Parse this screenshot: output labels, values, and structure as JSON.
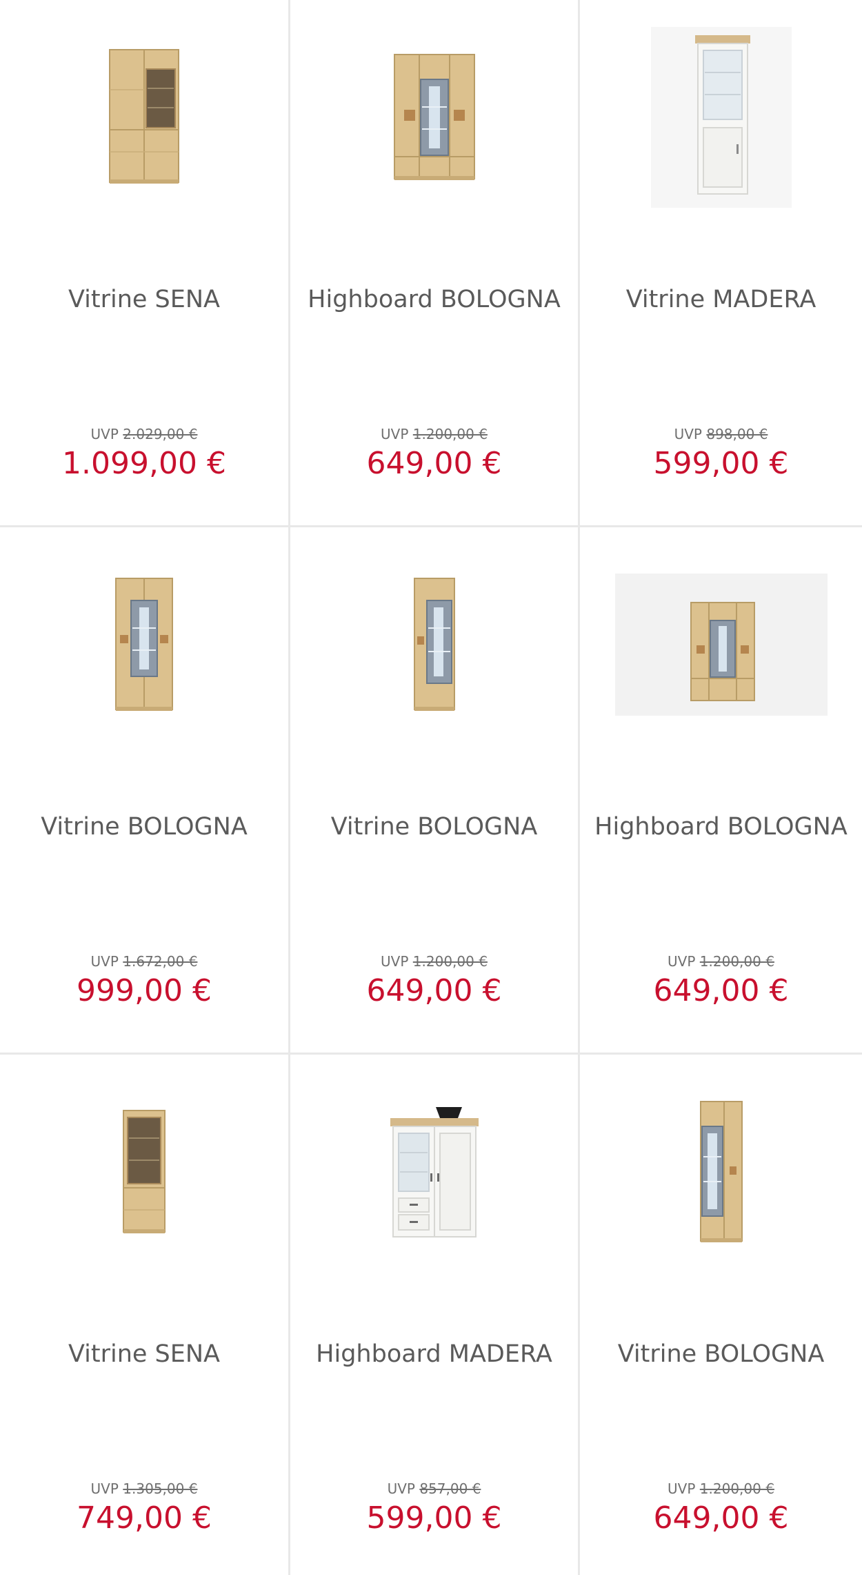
{
  "colors": {
    "price": "#c8102e",
    "title": "#5a5a5a",
    "uvp": "#6f6f6f",
    "divider": "#e8e8e8"
  },
  "uvp_prefix": "UVP",
  "products": [
    {
      "title": "Vitrine SENA",
      "uvp": "2.029,00 €",
      "price": "1.099,00 €",
      "image": "oak-vitrine-sena-two-door-icon"
    },
    {
      "title": "Highboard BOLOGNA",
      "uvp": "1.200,00 €",
      "price": "649,00 €",
      "image": "oak-highboard-bologna-icon"
    },
    {
      "title": "Vitrine MADERA",
      "uvp": "898,00 €",
      "price": "599,00 €",
      "image": "white-vitrine-madera-icon"
    },
    {
      "title": "Vitrine BOLOGNA",
      "uvp": "1.672,00 €",
      "price": "999,00 €",
      "image": "oak-vitrine-bologna-wide-icon"
    },
    {
      "title": "Vitrine BOLOGNA",
      "uvp": "1.200,00 €",
      "price": "649,00 €",
      "image": "oak-vitrine-bologna-narrow-icon"
    },
    {
      "title": "Highboard BOLOGNA",
      "uvp": "1.200,00 €",
      "price": "649,00 €",
      "image": "oak-highboard-bologna-studio-icon"
    },
    {
      "title": "Vitrine SENA",
      "uvp": "1.305,00 €",
      "price": "749,00 €",
      "image": "oak-vitrine-sena-narrow-icon"
    },
    {
      "title": "Highboard MADERA",
      "uvp": "857,00 €",
      "price": "599,00 €",
      "image": "white-highboard-madera-icon"
    },
    {
      "title": "Vitrine BOLOGNA",
      "uvp": "1.200,00 €",
      "price": "649,00 €",
      "image": "oak-vitrine-bologna-slim-icon"
    }
  ]
}
